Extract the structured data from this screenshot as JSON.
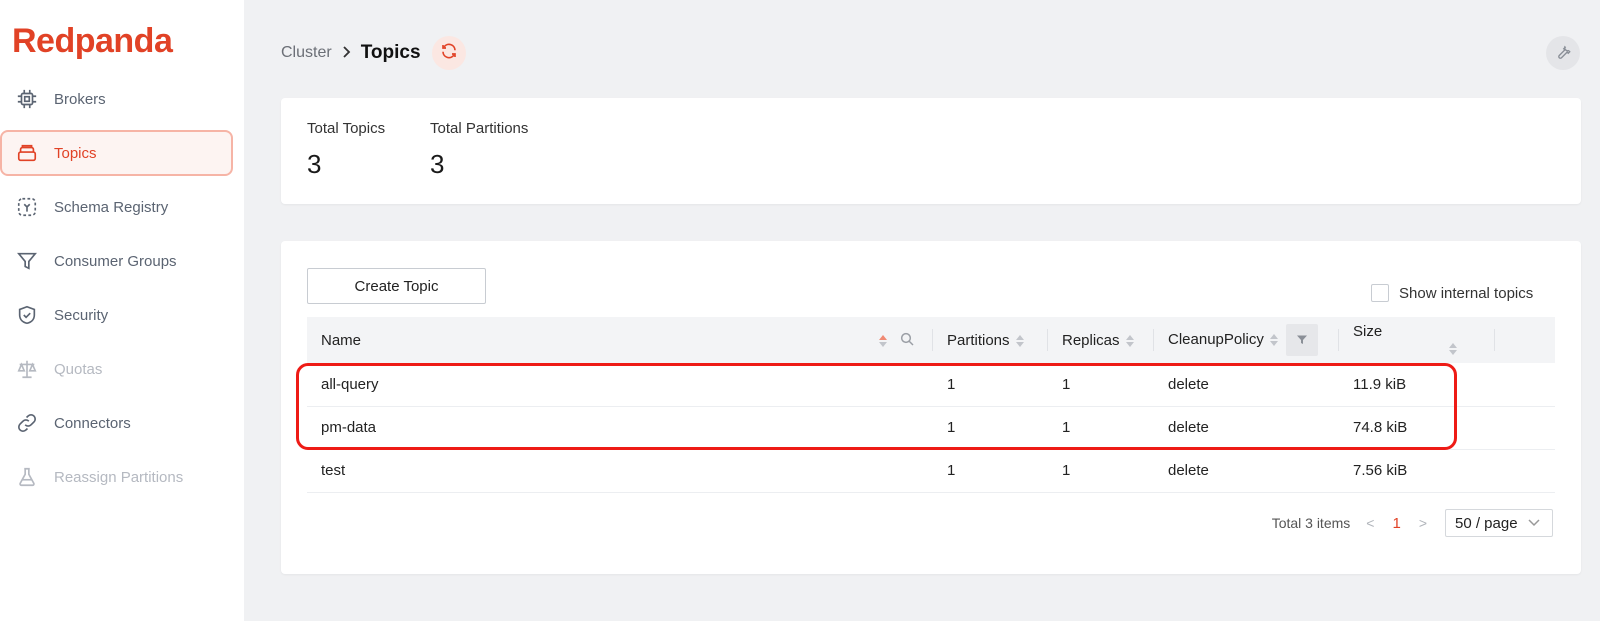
{
  "app": {
    "logo": "Redpanda",
    "accent": "#e14226"
  },
  "sidebar": {
    "items": [
      {
        "label": "Brokers",
        "icon": "chip-icon",
        "state": "normal"
      },
      {
        "label": "Topics",
        "icon": "stack-icon",
        "state": "active"
      },
      {
        "label": "Schema Registry",
        "icon": "schema-icon",
        "state": "normal"
      },
      {
        "label": "Consumer Groups",
        "icon": "funnel-icon",
        "state": "normal"
      },
      {
        "label": "Security",
        "icon": "shield-icon",
        "state": "normal"
      },
      {
        "label": "Quotas",
        "icon": "scale-icon",
        "state": "disabled"
      },
      {
        "label": "Connectors",
        "icon": "link-icon",
        "state": "normal"
      },
      {
        "label": "Reassign Partitions",
        "icon": "flask-icon",
        "state": "disabled"
      }
    ]
  },
  "header": {
    "breadcrumb_root": "Cluster",
    "breadcrumb_separator": ">",
    "title": "Topics"
  },
  "stats": {
    "total_topics_label": "Total Topics",
    "total_topics_value": "3",
    "total_partitions_label": "Total Partitions",
    "total_partitions_value": "3"
  },
  "toolbar": {
    "create_label": "Create Topic",
    "show_internal_label": "Show internal topics",
    "show_internal_checked": false
  },
  "table": {
    "columns": [
      "Name",
      "Partitions",
      "Replicas",
      "CleanupPolicy",
      "Size"
    ],
    "rows": [
      {
        "name": "all-query",
        "partitions": "1",
        "replicas": "1",
        "cleanup": "delete",
        "size": "11.9 kiB"
      },
      {
        "name": "pm-data",
        "partitions": "1",
        "replicas": "1",
        "cleanup": "delete",
        "size": "74.8 kiB"
      },
      {
        "name": "test",
        "partitions": "1",
        "replicas": "1",
        "cleanup": "delete",
        "size": "7.56 kiB"
      }
    ]
  },
  "pagination": {
    "total_label": "Total 3 items",
    "prev": "<",
    "current_page": "1",
    "next": ">",
    "page_size": "50 / page"
  }
}
